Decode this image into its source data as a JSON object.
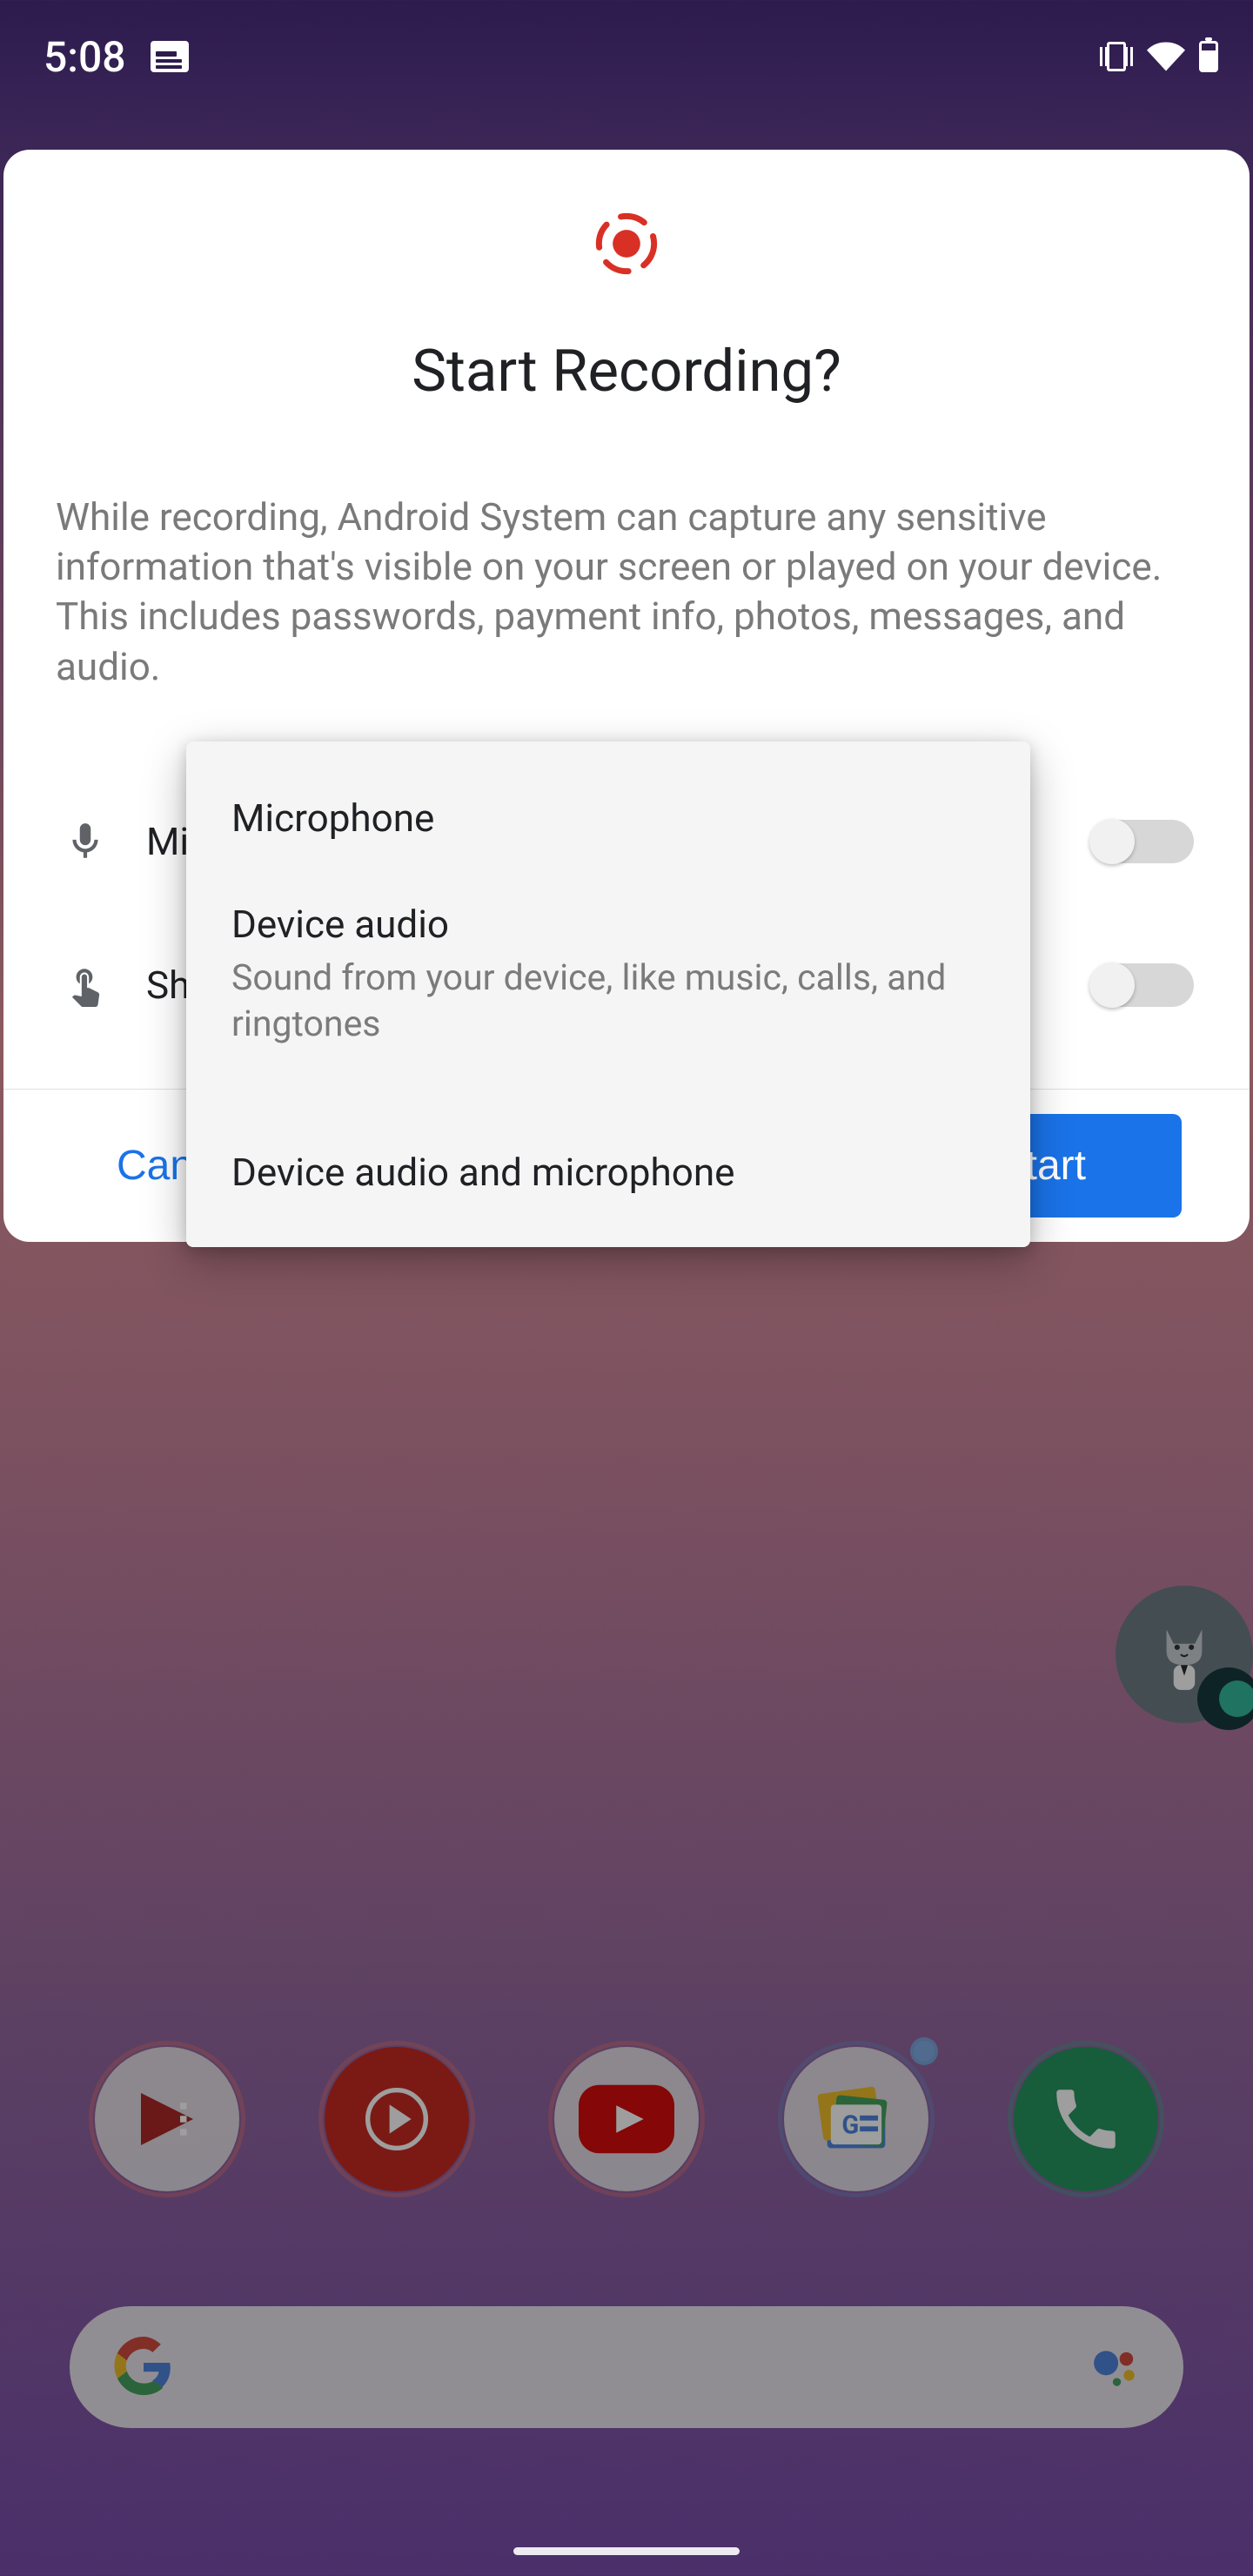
{
  "status_bar": {
    "time": "5:08"
  },
  "dialog": {
    "title": "Start Recording?",
    "description": "While recording, Android System can capture any sensitive information that's visible on your screen or played on your device. This includes passwords, payment info, photos, messages, and audio.",
    "option_audio_label": "Microphone",
    "option_touches_label": "Show touches on screen",
    "cancel_label": "Cancel",
    "start_label": "Start"
  },
  "dropdown": {
    "items": [
      {
        "title": "Microphone",
        "sub": ""
      },
      {
        "title": "Device audio",
        "sub": "Sound from your device, like music, calls, and ringtones"
      },
      {
        "title": "Device audio and microphone",
        "sub": ""
      }
    ]
  },
  "colors": {
    "accent": "#1a73e8",
    "record_red": "#d93025"
  }
}
